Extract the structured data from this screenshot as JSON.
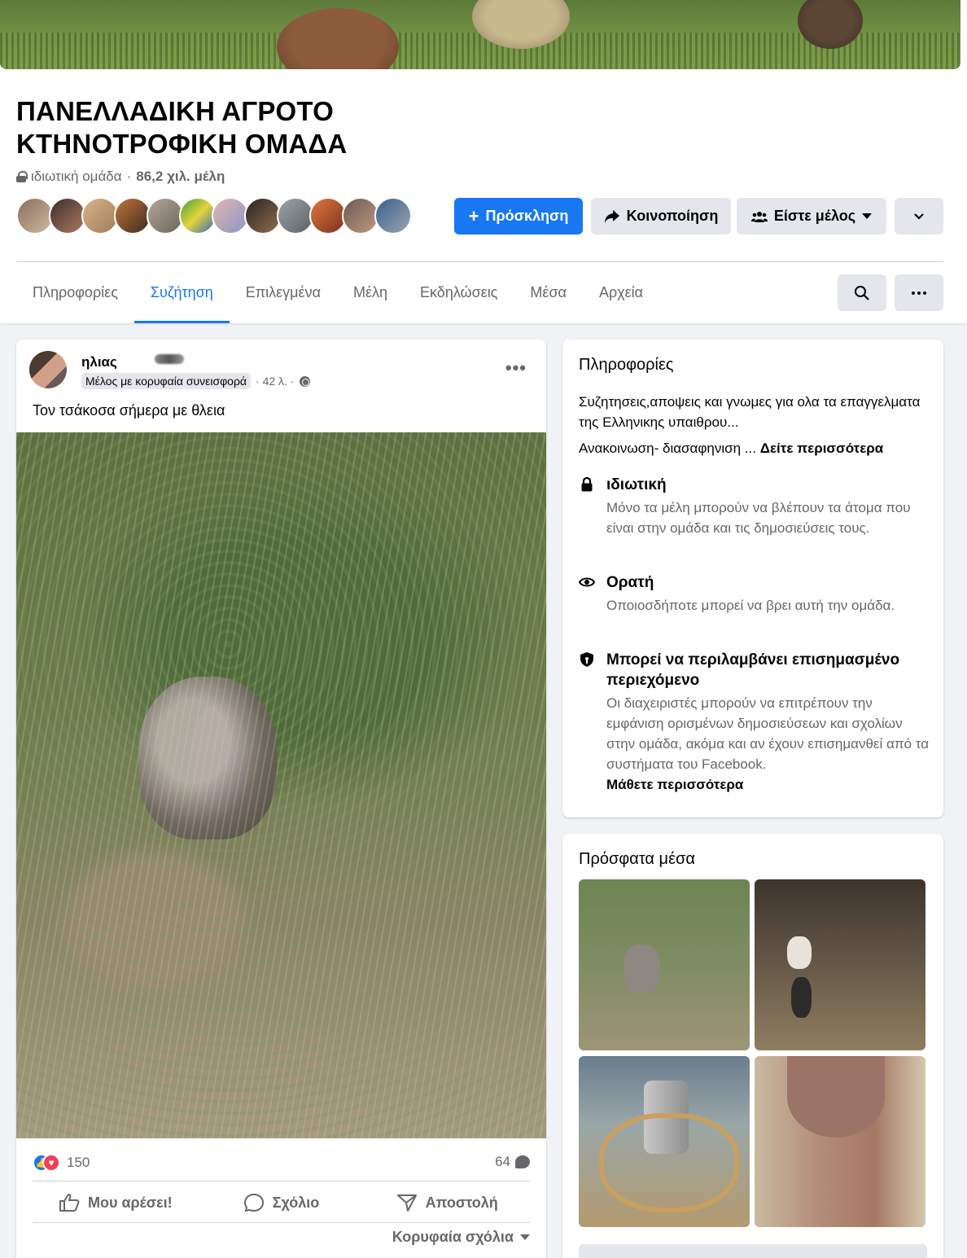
{
  "group": {
    "title": "ΠΑΝΕΛΛΑΔΙΚΗ ΑΓΡΟΤΟ ΚΤΗΝΟΤΡΟΦΙΚΗ ΟΜΑΔΑ",
    "privacy": "ιδιωτική ομάδα",
    "separator": "·",
    "members": "86,2 χιλ. μέλη"
  },
  "buttons": {
    "invite": "Πρόσκληση",
    "share": "Κοινοποίηση",
    "member": "Είστε μέλος"
  },
  "tabs": [
    {
      "label": "Πληροφορίες",
      "active": false
    },
    {
      "label": "Συζήτηση",
      "active": true
    },
    {
      "label": "Επιλεγμένα",
      "active": false
    },
    {
      "label": "Μέλη",
      "active": false
    },
    {
      "label": "Εκδηλώσεις",
      "active": false
    },
    {
      "label": "Μέσα",
      "active": false
    },
    {
      "label": "Αρχεία",
      "active": false
    }
  ],
  "post": {
    "author": "ηλιας",
    "badge": "Μέλος με κορυφαία συνεισφορά",
    "time": "· 42 λ. ·",
    "text": "Τον τσάκοσα σήμερα με θλεια",
    "reactions_count": "150",
    "comments_count": "64",
    "actions": {
      "like": "Μου αρέσει!",
      "comment": "Σχόλιο",
      "send": "Αποστολή"
    },
    "top_comments": "Κορυφαία σχόλια"
  },
  "info": {
    "title": "Πληροφορίες",
    "description": "Συζητησεις,αποψεις και γνωμες για ολα τα επαγγελματα της Ελληνικης υπαιθρου...",
    "announcement": "Ανακοινωση- διασαφηνιση ...",
    "see_more": "Δείτε περισσότερα",
    "items": [
      {
        "icon": "lock-icon",
        "title": "ιδιωτική",
        "desc": "Μόνο τα μέλη μπορούν να βλέπουν τα άτομα που είναι στην ομάδα και τις δημοσιεύσεις τους."
      },
      {
        "icon": "eye-icon",
        "title": "Ορατή",
        "desc": "Οποιοσδήποτε μπορεί να βρει αυτή την ομάδα."
      },
      {
        "icon": "shield-icon",
        "title": "Μπορεί να περιλαμβάνει επισημασμένο περιεχόμενο",
        "desc": "Οι διαχειριστές μπορούν να επιτρέπουν την εμφάνιση ορισμένων δημοσιεύσεων και σχολίων στην ομάδα, ακόμα και αν έχουν επισημανθεί από τα συστήματα του Facebook.",
        "link": "Μάθετε περισσότερα"
      }
    ]
  },
  "media": {
    "title": "Πρόσφατα μέσα"
  },
  "colors": {
    "accent": "#1877f2",
    "secondary_text": "#65676b",
    "button_gray": "#e4e6eb"
  }
}
